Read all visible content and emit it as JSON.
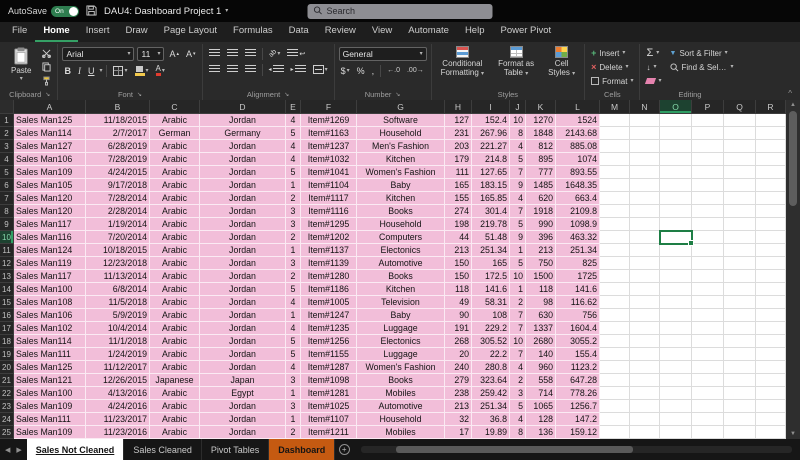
{
  "titlebar": {
    "autosave_label": "AutoSave",
    "autosave_state": "On",
    "title": "DAU4: Dashboard Project 1",
    "search_placeholder": "Search"
  },
  "menu": {
    "tabs": [
      "File",
      "Home",
      "Insert",
      "Draw",
      "Page Layout",
      "Formulas",
      "Data",
      "Review",
      "View",
      "Automate",
      "Help",
      "Power Pivot"
    ],
    "active_tab": "Home"
  },
  "ribbon": {
    "clipboard": {
      "paste": "Paste"
    },
    "font": {
      "name": "Arial",
      "size": "11"
    },
    "number": {
      "format": "General",
      "currency": "$",
      "percent": "%",
      "comma": ","
    },
    "styles": {
      "conditional_l1": "Conditional",
      "conditional_l2": "Formatting",
      "table_l1": "Format as",
      "table_l2": "Table",
      "cellstyles_l1": "Cell",
      "cellstyles_l2": "Styles"
    },
    "cells": {
      "insert": "Insert",
      "delete": "Delete",
      "format": "Format"
    },
    "editing": {
      "sort": "Sort & Filter",
      "find": "Find & Select"
    },
    "group_labels": {
      "clipboard": "Clipboard",
      "font": "Font",
      "alignment": "Alignment",
      "number": "Number",
      "styles": "Styles",
      "cells": "Cells",
      "editing": "Editing"
    }
  },
  "grid": {
    "columns": [
      "A",
      "B",
      "C",
      "D",
      "E",
      "F",
      "G",
      "H",
      "I",
      "J",
      "K",
      "L",
      "M",
      "N",
      "O",
      "P",
      "Q",
      "R"
    ],
    "selected_cell": {
      "column": "O",
      "row": 10
    },
    "rows": [
      [
        "Sales Man125",
        "11/18/2015",
        "Arabic",
        "Jordan",
        "4",
        "Item#1269",
        "Software",
        "127",
        "152.4",
        "10",
        "1270",
        "1524"
      ],
      [
        "Sales Man114",
        "2/7/2017",
        "German",
        "Germany",
        "5",
        "Item#1163",
        "Household",
        "231",
        "267.96",
        "8",
        "1848",
        "2143.68"
      ],
      [
        "Sales Man127",
        "6/28/2019",
        "Arabic",
        "Jordan",
        "4",
        "Item#1237",
        "Men's Fashion",
        "203",
        "221.27",
        "4",
        "812",
        "885.08"
      ],
      [
        "Sales Man106",
        "7/28/2019",
        "Arabic",
        "Jordan",
        "4",
        "Item#1032",
        "Kitchen",
        "179",
        "214.8",
        "5",
        "895",
        "1074"
      ],
      [
        "Sales Man109",
        "4/24/2015",
        "Arabic",
        "Jordan",
        "5",
        "Item#1041",
        "Women's Fashion",
        "111",
        "127.65",
        "7",
        "777",
        "893.55"
      ],
      [
        "Sales Man105",
        "9/17/2018",
        "Arabic",
        "Jordan",
        "1",
        "Item#1104",
        "Baby",
        "165",
        "183.15",
        "9",
        "1485",
        "1648.35"
      ],
      [
        "Sales Man120",
        "7/28/2014",
        "Arabic",
        "Jordan",
        "2",
        "Item#1117",
        "Kitchen",
        "155",
        "165.85",
        "4",
        "620",
        "663.4"
      ],
      [
        "Sales Man120",
        "2/28/2014",
        "Arabic",
        "Jordan",
        "3",
        "Item#1116",
        "Books",
        "274",
        "301.4",
        "7",
        "1918",
        "2109.8"
      ],
      [
        "Sales Man117",
        "1/19/2014",
        "Arabic",
        "Jordan",
        "3",
        "Item#1295",
        "Household",
        "198",
        "219.78",
        "5",
        "990",
        "1098.9"
      ],
      [
        "Sales Man116",
        "7/20/2014",
        "Arabic",
        "Jordan",
        "2",
        "Item#1202",
        "Computers",
        "44",
        "51.48",
        "9",
        "396",
        "463.32"
      ],
      [
        "Sales Man124",
        "10/18/2015",
        "Arabic",
        "Jordan",
        "1",
        "Item#1137",
        "Electonics",
        "213",
        "251.34",
        "1",
        "213",
        "251.34"
      ],
      [
        "Sales Man119",
        "12/23/2018",
        "Arabic",
        "Jordan",
        "3",
        "Item#1139",
        "Automotive",
        "150",
        "165",
        "5",
        "750",
        "825"
      ],
      [
        "Sales Man117",
        "11/13/2014",
        "Arabic",
        "Jordan",
        "2",
        "Item#1280",
        "Books",
        "150",
        "172.5",
        "10",
        "1500",
        "1725"
      ],
      [
        "Sales Man100",
        "6/8/2014",
        "Arabic",
        "Jordan",
        "5",
        "Item#1186",
        "Kitchen",
        "118",
        "141.6",
        "1",
        "118",
        "141.6"
      ],
      [
        "Sales Man108",
        "11/5/2018",
        "Arabic",
        "Jordan",
        "4",
        "Item#1005",
        "Television",
        "49",
        "58.31",
        "2",
        "98",
        "116.62"
      ],
      [
        "Sales Man106",
        "5/9/2019",
        "Arabic",
        "Jordan",
        "1",
        "Item#1247",
        "Baby",
        "90",
        "108",
        "7",
        "630",
        "756"
      ],
      [
        "Sales Man102",
        "10/4/2014",
        "Arabic",
        "Jordan",
        "4",
        "Item#1235",
        "Luggage",
        "191",
        "229.2",
        "7",
        "1337",
        "1604.4"
      ],
      [
        "Sales Man114",
        "11/1/2018",
        "Arabic",
        "Jordan",
        "5",
        "Item#1256",
        "Electonics",
        "268",
        "305.52",
        "10",
        "2680",
        "3055.2"
      ],
      [
        "Sales Man111",
        "1/24/2019",
        "Arabic",
        "Jordan",
        "5",
        "Item#1155",
        "Luggage",
        "20",
        "22.2",
        "7",
        "140",
        "155.4"
      ],
      [
        "Sales Man125",
        "11/12/2017",
        "Arabic",
        "Jordan",
        "4",
        "Item#1287",
        "Women's Fashion",
        "240",
        "280.8",
        "4",
        "960",
        "1123.2"
      ],
      [
        "Sales Man121",
        "12/26/2015",
        "Japanese",
        "Japan",
        "3",
        "Item#1098",
        "Books",
        "279",
        "323.64",
        "2",
        "558",
        "647.28"
      ],
      [
        "Sales Man100",
        "4/13/2016",
        "Arabic",
        "Egypt",
        "1",
        "Item#1281",
        "Mobiles",
        "238",
        "259.42",
        "3",
        "714",
        "778.26"
      ],
      [
        "Sales Man109",
        "4/24/2016",
        "Arabic",
        "Jordan",
        "3",
        "Item#1025",
        "Automotive",
        "213",
        "251.34",
        "5",
        "1065",
        "1256.7"
      ],
      [
        "Sales Man111",
        "11/23/2017",
        "Arabic",
        "Jordan",
        "1",
        "Item#1107",
        "Household",
        "32",
        "36.8",
        "4",
        "128",
        "147.2"
      ],
      [
        "Sales Man109",
        "11/23/2016",
        "Arabic",
        "Jordan",
        "2",
        "Item#1211",
        "Mobiles",
        "17",
        "19.89",
        "8",
        "136",
        "159.12"
      ]
    ]
  },
  "sheet_tabs": {
    "tabs": [
      {
        "label": "Sales Not Cleaned",
        "active": true
      },
      {
        "label": "Sales Cleaned",
        "active": false
      },
      {
        "label": "Pivot Tables",
        "active": false
      },
      {
        "label": "Dashboard",
        "active": false,
        "color": "#c55a11"
      }
    ],
    "add_button": "+"
  },
  "colors": {
    "data_fill": "#f2bed9",
    "accent_green": "#1e7e45",
    "dashboard_tab": "#c55a11"
  }
}
